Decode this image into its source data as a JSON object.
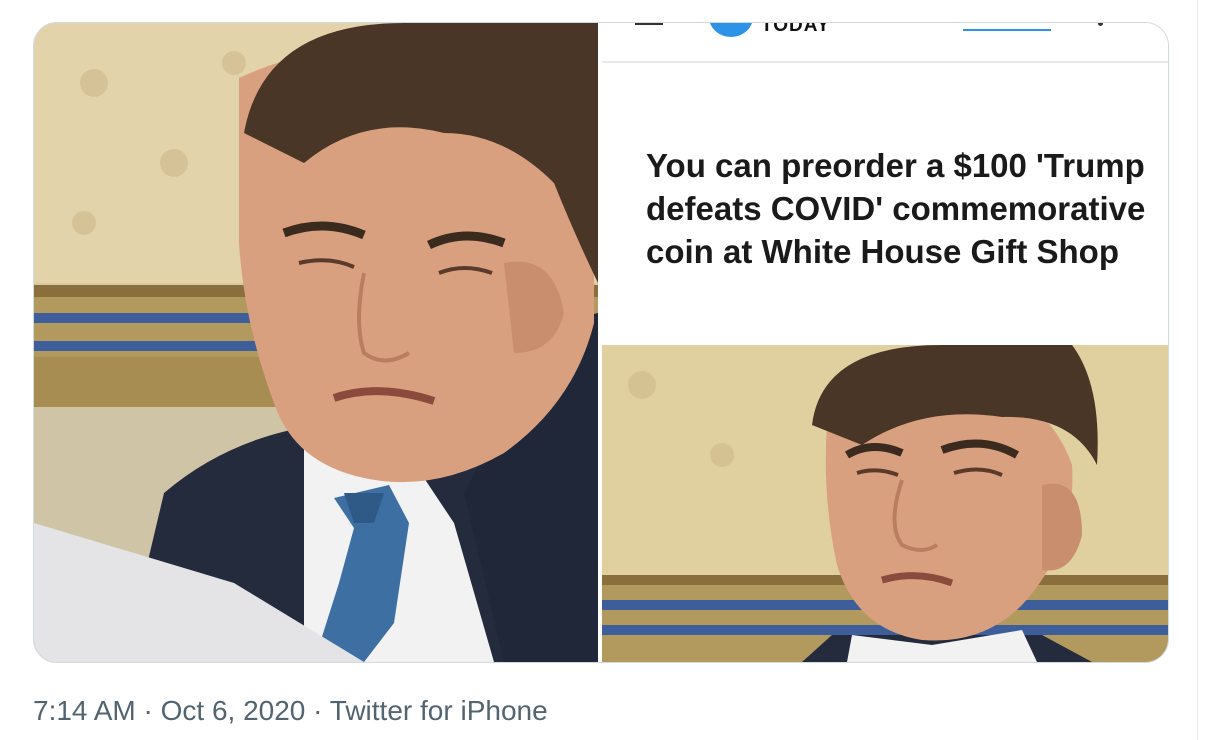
{
  "tweet": {
    "time": "7:14 AM",
    "separator": " · ",
    "date": "Oct 6, 2020",
    "source": "Twitter for iPhone"
  },
  "media": {
    "article_card": {
      "brand": "TODAY",
      "headline": "You can preorder a $100 'Trump defeats COVID' commemorative coin at White House Gift Shop"
    },
    "colors": {
      "wall": "#d8c79a",
      "suit": "#232b3d",
      "tie": "#3d6fa3",
      "skin": "#d9a07f",
      "hair": "#4a3626",
      "trim": "#8a6f3c",
      "brand_blue": "#2c93e8",
      "meta_text": "#536471"
    }
  }
}
